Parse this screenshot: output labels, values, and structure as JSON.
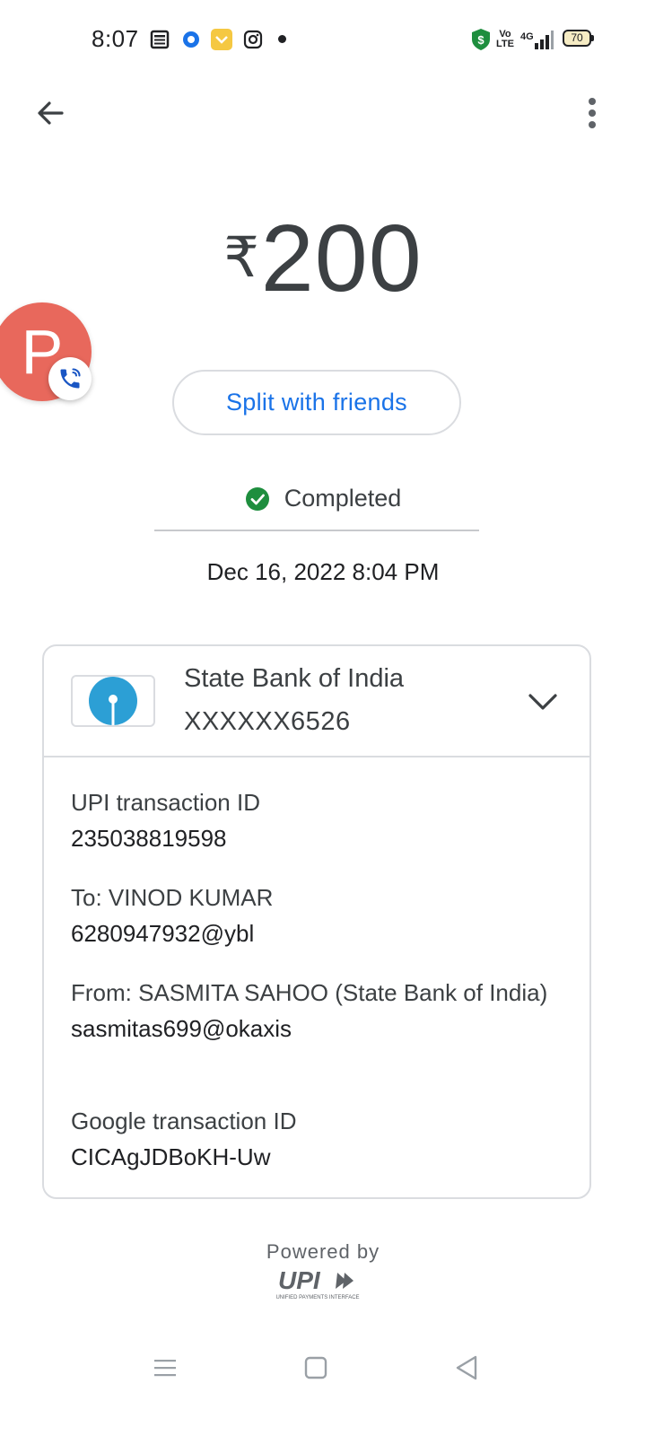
{
  "status_bar": {
    "time": "8:07",
    "network": "4G",
    "volte": "Vo LTE",
    "battery": "70",
    "icons": [
      "news-icon",
      "browser-icon",
      "chat-icon",
      "instagram-icon",
      "notification-dot",
      "shield-icon",
      "signal-icon",
      "battery-icon"
    ]
  },
  "payment": {
    "currency_symbol": "₹",
    "amount": "200",
    "split_label": "Split with friends",
    "status": "Completed",
    "datetime": "Dec 16, 2022 8:04 PM"
  },
  "chathead": {
    "letter": "P",
    "color": "#e8685c"
  },
  "bank": {
    "name": "State Bank of India",
    "account": "XXXXXX6526"
  },
  "details": {
    "upi_label": "UPI transaction ID",
    "upi_id": "235038819598",
    "to_label": "To: VINOD KUMAR",
    "to_id": "6280947932@ybl",
    "from_label": "From: SASMITA  SAHOO (State Bank of India)",
    "from_id": "sasmitas699@okaxis",
    "google_label": "Google transaction ID",
    "google_id": "CICAgJDBoKH-Uw"
  },
  "footer": {
    "powered_by": "Powered by",
    "upi_text": "UPI",
    "upi_subtext": "UNIFIED PAYMENTS INTERFACE"
  },
  "colors": {
    "accent": "#1a73e8",
    "success": "#1e8e3e",
    "sbi_blue": "#2c9fd5"
  }
}
